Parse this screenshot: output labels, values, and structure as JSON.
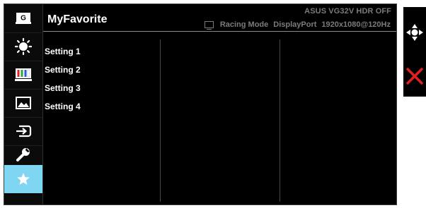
{
  "page": {
    "title": "MyFavorite",
    "model_status": "ASUS VG32V HDR OFF",
    "info": {
      "mode": "Racing Mode",
      "input": "DisplayPort",
      "resolution": "1920x1080@120Hz"
    }
  },
  "sidebar": {
    "items": [
      {
        "name": "gameplus",
        "icon": "gameplus-icon",
        "label": "G"
      },
      {
        "name": "splendid",
        "icon": "brightness-icon"
      },
      {
        "name": "color",
        "icon": "color-bars-icon"
      },
      {
        "name": "image",
        "icon": "image-icon"
      },
      {
        "name": "input-select",
        "icon": "input-select-icon"
      },
      {
        "name": "system-setup",
        "icon": "wrench-icon"
      },
      {
        "name": "myfavorite",
        "icon": "star-icon",
        "active": true
      }
    ]
  },
  "menu": {
    "items": [
      "Setting 1",
      "Setting 2",
      "Setting 3",
      "Setting 4"
    ]
  },
  "key_guide": {
    "items": [
      {
        "icon": "five-way-navigation-icon"
      },
      {
        "icon": "close-icon"
      }
    ]
  },
  "colors": {
    "panel_bg": "#000000",
    "accent_active": "#7fd6f2",
    "close_red": "#e02020",
    "header_text": "#7b7b7b"
  }
}
